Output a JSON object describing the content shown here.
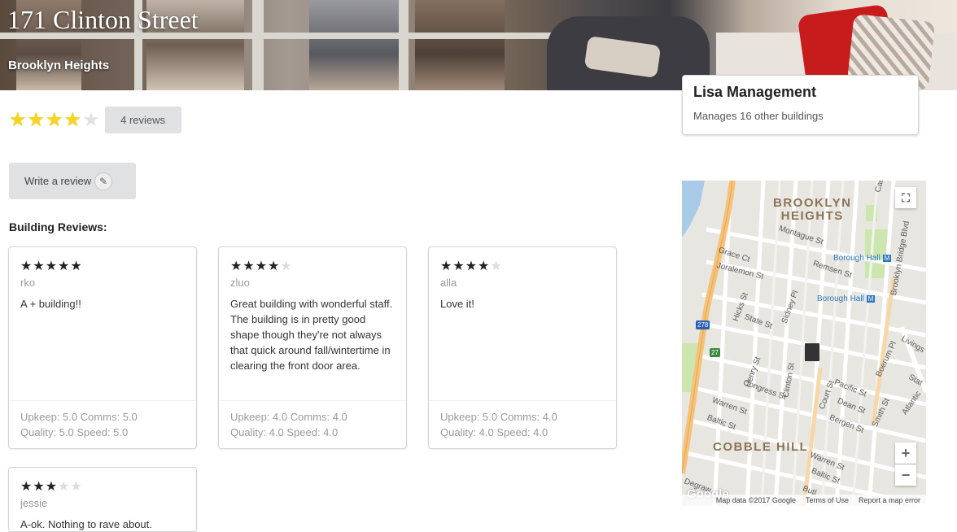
{
  "building": {
    "title": "171 Clinton Street",
    "neighborhood": "Brooklyn Heights",
    "rating": 4,
    "max_rating": 5,
    "reviews_label": "4 reviews"
  },
  "actions": {
    "write_review_label": "Write a review",
    "pencil_icon": "pencil-icon"
  },
  "section_label": "Building Reviews:",
  "reviews": [
    {
      "stars": 5,
      "author": "rko",
      "text": "A + building!!",
      "line1": "Upkeep: 5.0 Comms: 5.0",
      "line2": "Quality: 5.0 Speed: 5.0"
    },
    {
      "stars": 4,
      "author": "zluo",
      "text": "Great building with wonderful staff. The building is in pretty good shape though they're not always that quick around fall/wintertime in clearing the front door area.",
      "line1": "Upkeep: 4.0 Comms: 4.0",
      "line2": "Quality: 4.0 Speed: 4.0"
    },
    {
      "stars": 4,
      "author": "alla",
      "text": "Love it!",
      "line1": "Upkeep: 5.0 Comms: 4.0",
      "line2": "Quality: 4.0 Speed: 4.0"
    },
    {
      "stars": 3,
      "author": "jessie",
      "text": "A-ok. Nothing to rave about.",
      "line1": "",
      "line2": ""
    }
  ],
  "management": {
    "name": "Lisa Management",
    "meta": "Manages 16 other buildings"
  },
  "map": {
    "area_1_line1": "BROOKLYN",
    "area_1_line2": "HEIGHTS",
    "area_2": "COBBLE HILL",
    "streets": {
      "montague": "Montague St",
      "remsen": "Remsen St",
      "grace": "Grace Ct",
      "joralemon": "Joralemon St",
      "hicks": "Hicks St",
      "henry": "Henry St",
      "sidney": "Sidney Pl",
      "clinton": "Clinton St",
      "state": "State St",
      "court": "Court St",
      "pacific": "Pacific St",
      "dean": "Dean St",
      "bergen": "Bergen St",
      "smith": "Smith St",
      "boerum": "Boerum Pl",
      "congress": "Congress St",
      "warren1": "Warren St",
      "warren2": "Warren St",
      "baltic1": "Baltic St",
      "baltic2": "Baltic St",
      "bridge": "Brooklyn Bridge Blvd",
      "livingston": "Livings",
      "atlantic": "Atlantic",
      "stat": "Stat",
      "degraw": "Degraw",
      "butler": "Butl",
      "cad": "Cad"
    },
    "boro_hall_1": "Borough Hall",
    "boro_hall_2": "Borough Hall",
    "route_278": "278",
    "route_27": "27",
    "zoom_in": "+",
    "zoom_out": "−",
    "fullscreen_icon": "fullscreen-icon",
    "google_logo": "Google",
    "attribution": "Map data ©2017 Google",
    "terms": "Terms of Use",
    "report": "Report a map error"
  }
}
